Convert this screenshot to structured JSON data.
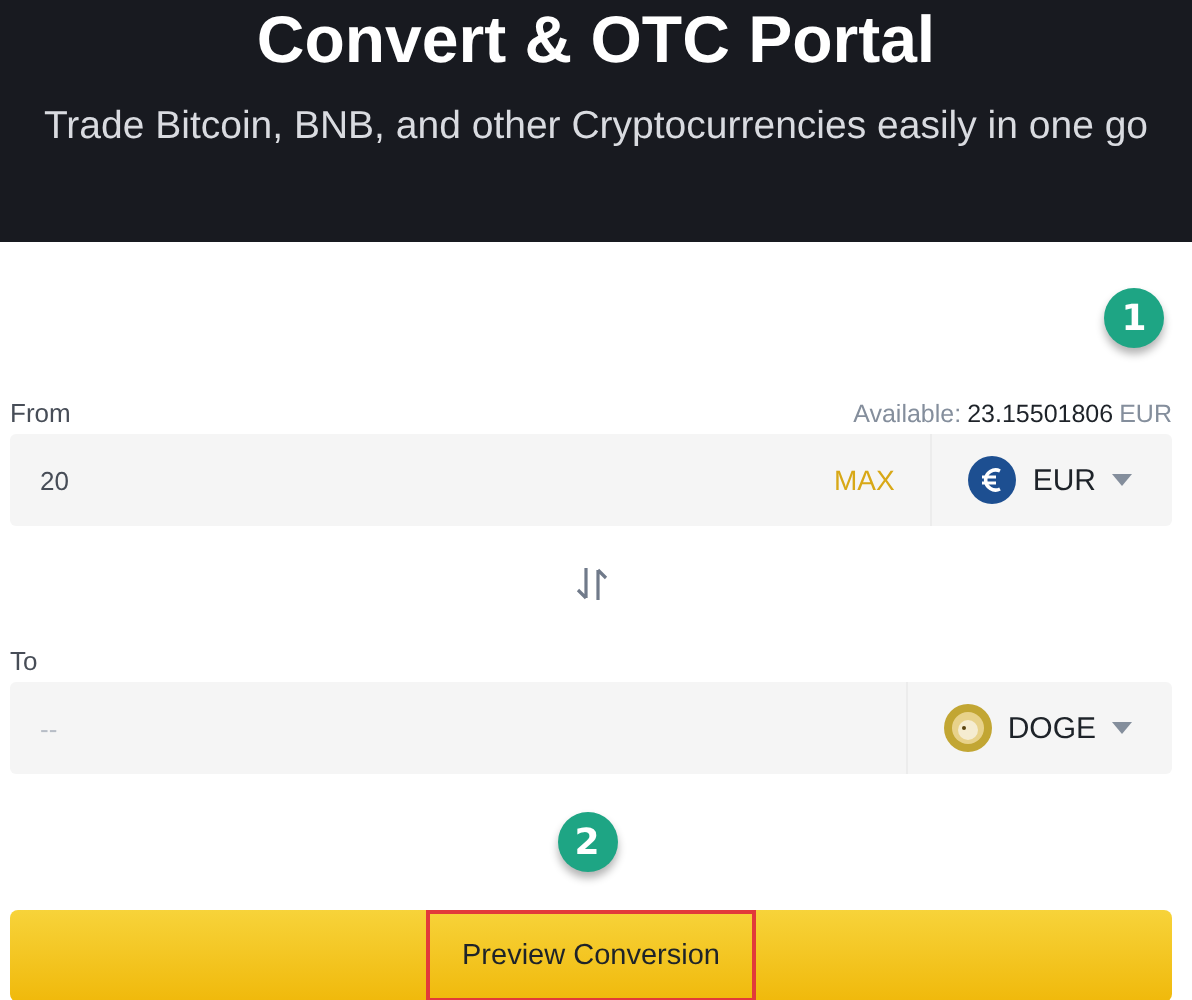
{
  "header": {
    "title": "Convert & OTC Portal",
    "subtitle": "Trade Bitcoin, BNB, and other Cryptocurrencies easily in one go"
  },
  "from": {
    "label": "From",
    "available_label": "Available:",
    "available_amount": "23.15501806",
    "available_currency": "EUR",
    "value": "20",
    "max": "MAX",
    "currency": {
      "code": "EUR",
      "kind": "euro"
    }
  },
  "to": {
    "label": "To",
    "placeholder": "--",
    "currency": {
      "code": "DOGE",
      "kind": "doge"
    }
  },
  "steps": [
    "1",
    "2"
  ],
  "button": {
    "label": "Preview Conversion",
    "highlighted": true
  }
}
